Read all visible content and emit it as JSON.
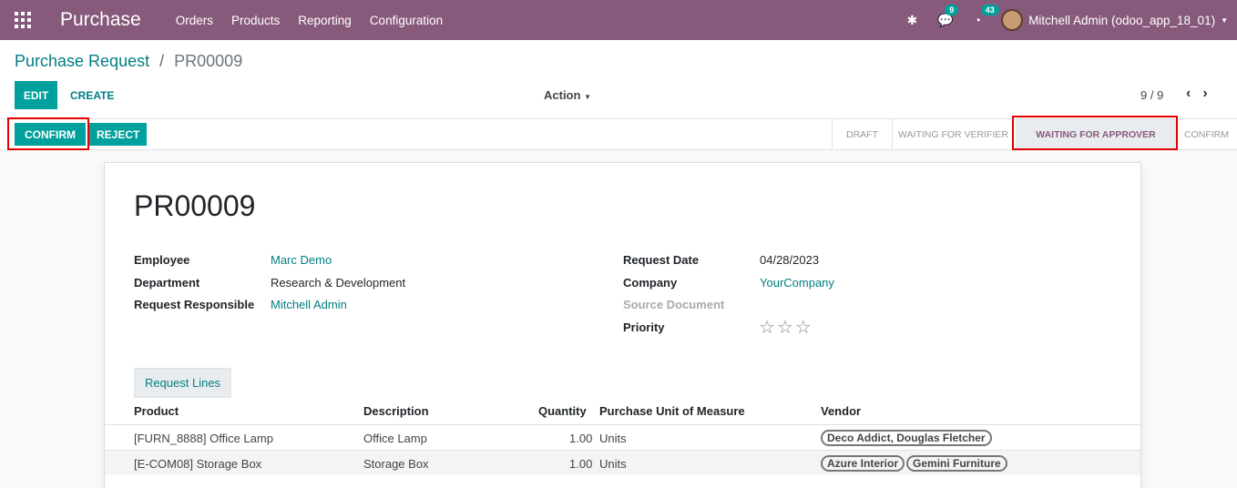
{
  "navbar": {
    "app_name": "Purchase",
    "menu": [
      "Orders",
      "Products",
      "Reporting",
      "Configuration"
    ],
    "messages_count": "9",
    "activities_count": "43",
    "user": "Mitchell Admin (odoo_app_18_01)",
    "brand_color": "#875a7b"
  },
  "breadcrumb": {
    "parent": "Purchase Request",
    "separator": "/",
    "current": "PR00009"
  },
  "toolbar": {
    "edit_label": "EDIT",
    "create_label": "CREATE",
    "action_label": "Action",
    "pager": "9 / 9"
  },
  "statusbar": {
    "confirm_label": "CONFIRM",
    "reject_label": "REJECT",
    "stages": [
      "DRAFT",
      "WAITING FOR VERIFIER",
      "WAITING FOR APPROVER",
      "CONFIRM"
    ],
    "active_stage": "WAITING FOR APPROVER"
  },
  "form": {
    "title": "PR00009",
    "employee_label": "Employee",
    "employee": "Marc Demo",
    "department_label": "Department",
    "department": "Research & Development",
    "responsible_label": "Request Responsible",
    "responsible": "Mitchell Admin",
    "request_date_label": "Request Date",
    "request_date": "04/28/2023",
    "company_label": "Company",
    "company": "YourCompany",
    "source_label": "Source Document",
    "priority_label": "Priority",
    "priority_stars": 0
  },
  "lines": {
    "tab_label": "Request Lines",
    "headers": [
      "Product",
      "Description",
      "Quantity",
      "Purchase Unit of Measure",
      "Vendor"
    ],
    "rows": [
      {
        "product": "[FURN_8888] Office Lamp",
        "description": "Office Lamp",
        "quantity": "1.00",
        "uom": "Units",
        "vendors": [
          "Deco Addict, Douglas Fletcher"
        ]
      },
      {
        "product": "[E-COM08] Storage Box",
        "description": "Storage Box",
        "quantity": "1.00",
        "uom": "Units",
        "vendors": [
          "Azure Interior",
          "Gemini Furniture"
        ]
      }
    ]
  }
}
